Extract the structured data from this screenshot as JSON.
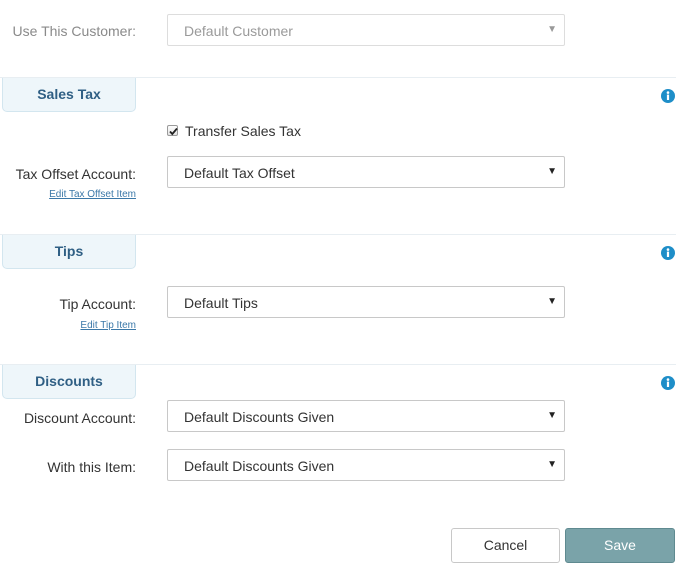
{
  "customer": {
    "label": "Use This Customer:",
    "value": "Default Customer"
  },
  "sales_tax": {
    "section_title": "Sales Tax",
    "info_icon": "info-circle-icon",
    "transfer_checkbox_label": "Transfer Sales Tax",
    "transfer_checked": true,
    "offset_label": "Tax Offset Account:",
    "offset_value": "Default Tax Offset",
    "edit_link": "Edit Tax Offset Item"
  },
  "tips": {
    "section_title": "Tips",
    "info_icon": "info-circle-icon",
    "account_label": "Tip Account:",
    "account_value": "Default Tips",
    "edit_link": "Edit Tip Item"
  },
  "discounts": {
    "section_title": "Discounts",
    "info_icon": "info-circle-icon",
    "account_label": "Discount Account:",
    "account_value": "Default Discounts Given",
    "item_label": "With this Item:",
    "item_value": "Default Discounts Given"
  },
  "buttons": {
    "cancel": "Cancel",
    "save": "Save"
  },
  "colors": {
    "section_title": "#2f5f84",
    "info_icon": "#1e8ec8",
    "save_button": "#7aa3a9",
    "link": "#3b78a8"
  }
}
